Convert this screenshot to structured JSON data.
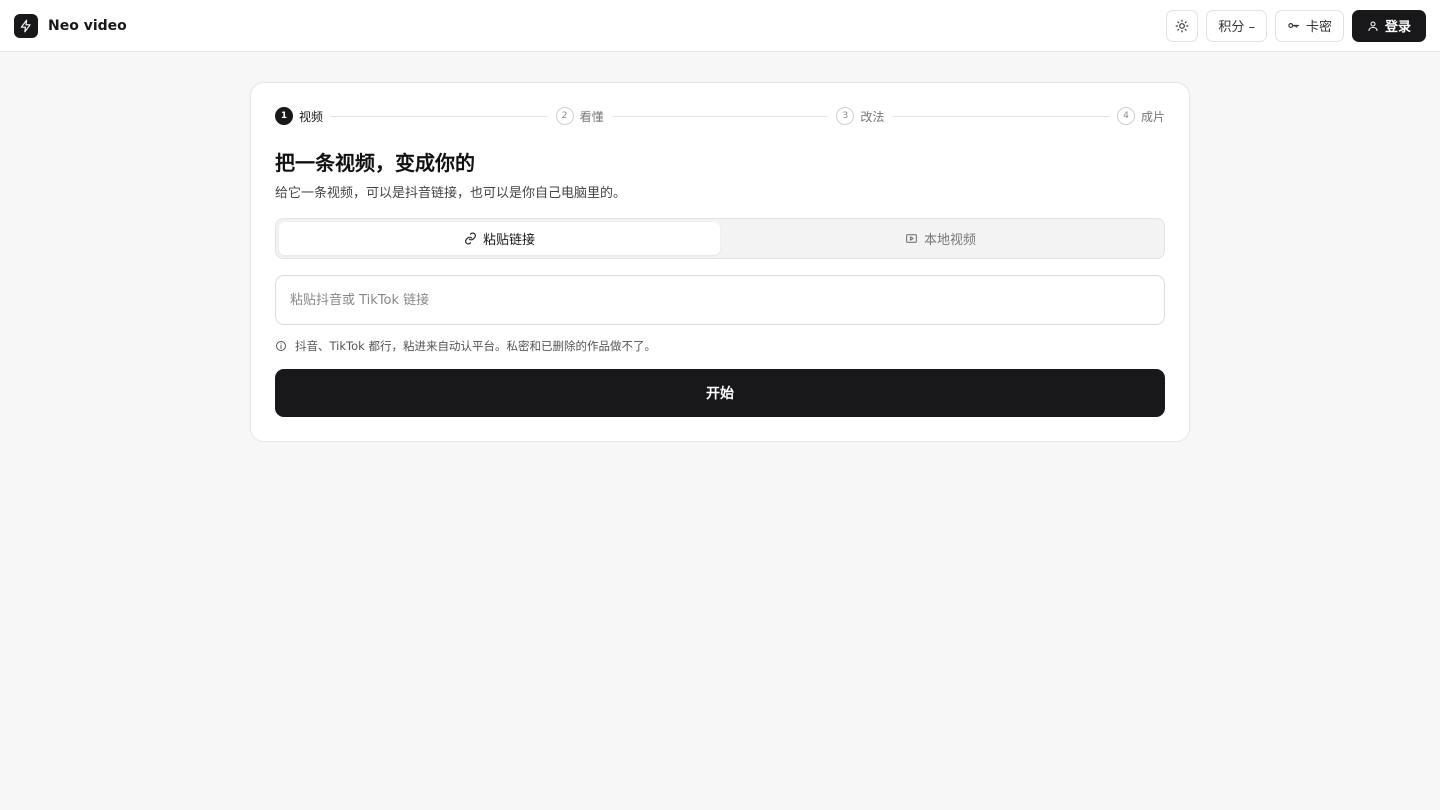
{
  "app": {
    "name": "Neo video",
    "icons": {
      "logo": "lightning-bolt-icon",
      "theme": "sun-icon",
      "key": "key-icon",
      "user": "user-icon"
    }
  },
  "header": {
    "points_label": "积分 –",
    "card_key_label": "卡密",
    "login_label": "登录"
  },
  "steps": [
    {
      "num": "1",
      "label": "视频",
      "active": true
    },
    {
      "num": "2",
      "label": "看懂",
      "active": false
    },
    {
      "num": "3",
      "label": "改法",
      "active": false
    },
    {
      "num": "4",
      "label": "成片",
      "active": false
    }
  ],
  "main": {
    "title": "把一条视频，变成你的",
    "subtitle": "给它一条视频，可以是抖音链接，也可以是你自己电脑里的。",
    "tabs": [
      {
        "label": "粘贴链接",
        "icon": "link-icon",
        "active": true
      },
      {
        "label": "本地视频",
        "icon": "video-icon",
        "active": false
      }
    ],
    "input": {
      "value": "",
      "placeholder": "粘贴抖音或 TikTok 链接"
    },
    "hint": "抖音、TikTok 都行，粘进来自动认平台。私密和已删除的作品做不了。",
    "start_label": "开始"
  },
  "colors": {
    "accent": "#18181b",
    "background": "#f7f7f7",
    "card": "#ffffff",
    "border": "#e6e6e6"
  }
}
